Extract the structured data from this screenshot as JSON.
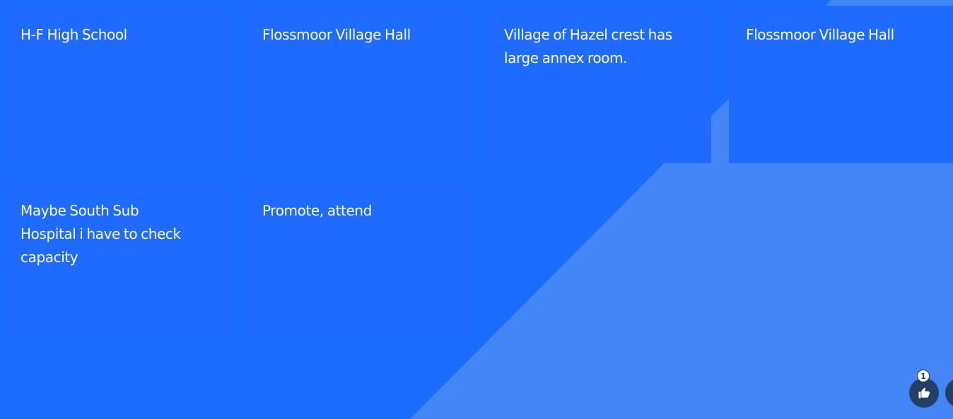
{
  "colors": {
    "background": "#1a6cff",
    "background_lighter": "#4486f8",
    "card": "#1f6bff",
    "card_text": "#ffffff",
    "like_button": "#243f66"
  },
  "cards": [
    {
      "text": "H-F High School"
    },
    {
      "text": "Flossmoor Village Hall"
    },
    {
      "text": "Village of Hazel crest has\nlarge annex room."
    },
    {
      "text": "Flossmoor Village Hall"
    },
    {
      "text": "Maybe South Sub\nHospital i have to check\ncapacity"
    },
    {
      "text": "Promote, attend"
    }
  ],
  "reactions": {
    "like_icon": "thumbs-up-icon",
    "like_count": "1"
  }
}
